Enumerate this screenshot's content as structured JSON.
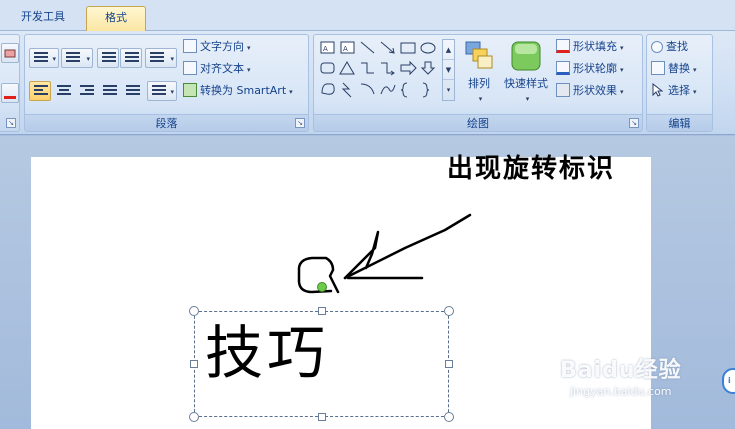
{
  "tabs": {
    "developer": "开发工具",
    "format": "格式"
  },
  "paragraph": {
    "text_direction": "文字方向",
    "align_text": "对齐文本",
    "convert_smartart": "转换为 SmartArt",
    "group_label": "段落"
  },
  "drawing": {
    "arrange": "排列",
    "quick_styles": "快速样式",
    "shape_fill": "形状填充",
    "shape_outline": "形状轮廓",
    "shape_effects": "形状效果",
    "group_label": "绘图"
  },
  "editing": {
    "find": "查找",
    "replace": "替换",
    "select": "选择",
    "group_label": "编辑"
  },
  "slide": {
    "annotation": "出现旋转标识",
    "textbox_text": "技巧"
  },
  "watermark": {
    "logo": "Baidu经验",
    "url": "jingyan.baidu.com"
  },
  "colors": {
    "rotation_handle": "#6ecb4a",
    "ribbon_bg": "#dbe6f4",
    "active_button": "#ffcf6b"
  }
}
